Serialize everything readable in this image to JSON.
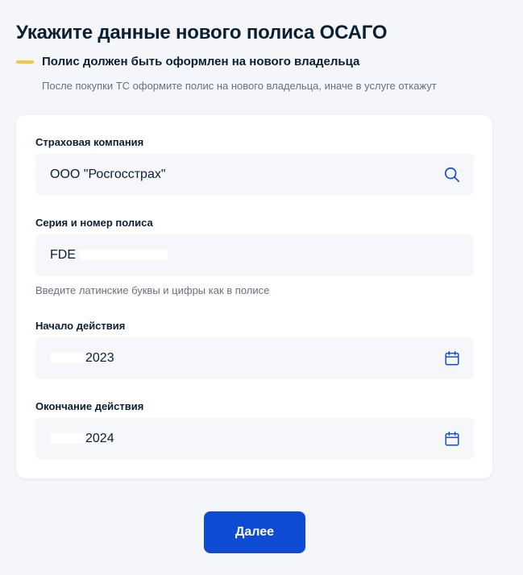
{
  "page": {
    "title": "Укажите данные нового полиса ОСАГО",
    "notice": {
      "text": "Полис должен быть оформлен на нового владельца",
      "subtext": "После покупки ТС оформите полис на нового владельца, иначе в услуге откажут",
      "accent_color": "#f5c935"
    }
  },
  "form": {
    "insurer": {
      "label": "Страховая компания",
      "value": "ООО \"Росгосстрах\"",
      "icon": "search-icon"
    },
    "policy_number": {
      "label": "Серия и номер полиса",
      "value": "FDE",
      "hint": "Введите латинские буквы и цифры как в полисе"
    },
    "start_date": {
      "label": "Начало действия",
      "value": "2023",
      "icon": "calendar-icon"
    },
    "end_date": {
      "label": "Окончание действия",
      "value": "2024",
      "icon": "calendar-icon"
    }
  },
  "actions": {
    "next_label": "Далее",
    "button_color": "#0d4cd3"
  }
}
